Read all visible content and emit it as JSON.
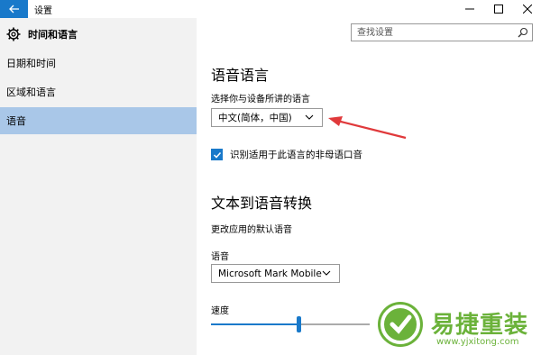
{
  "window": {
    "title": "设置"
  },
  "sidebar": {
    "header": "时间和语言",
    "items": [
      {
        "label": "日期和时间",
        "active": false
      },
      {
        "label": "区域和语言",
        "active": false
      },
      {
        "label": "语音",
        "active": true
      }
    ]
  },
  "search": {
    "placeholder": "查找设置"
  },
  "speech_language": {
    "heading": "语音语言",
    "prompt": "选择你与设备所讲的语言",
    "selected": "中文(简体，中国)",
    "checkbox_label": "识别适用于此语言的非母语口音",
    "checkbox_checked": true
  },
  "tts": {
    "heading": "文本到语音转换",
    "description": "更改应用的默认语音",
    "voice_label": "语音",
    "voice_selected": "Microsoft Mark Mobile",
    "speed_label": "速度",
    "speed_level": 0.55
  },
  "watermark": {
    "title": "易捷重装",
    "url": "www.yjxitong.com"
  },
  "colors": {
    "accent": "#1979ca",
    "active_item": "#a9c7e8",
    "sidebar_bg": "#f2f2f2",
    "annotation_arrow": "#e0393b",
    "watermark_green": "#6bb23a"
  }
}
